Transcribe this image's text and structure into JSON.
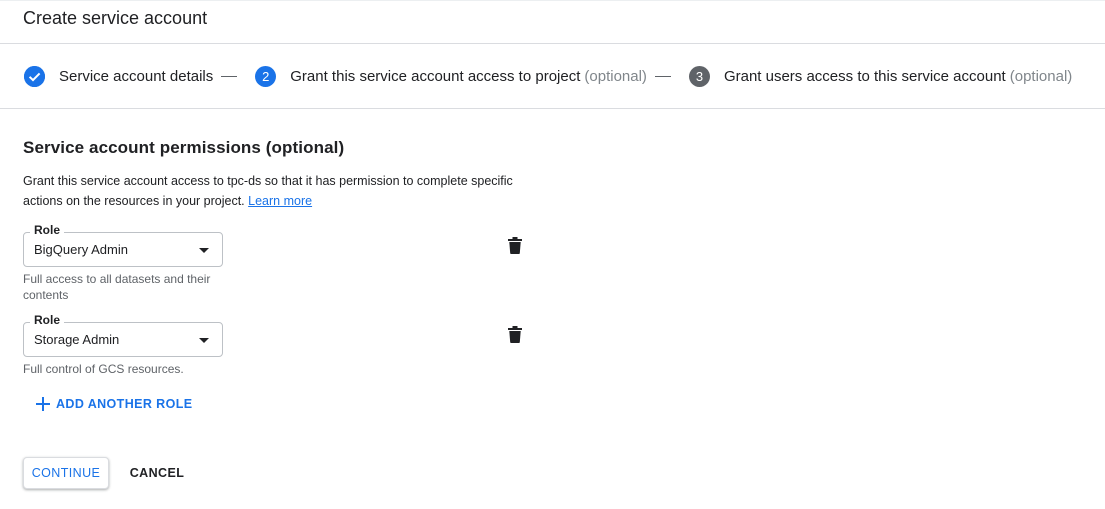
{
  "header": {
    "title": "Create service account"
  },
  "stepper": {
    "steps": [
      {
        "badge": "",
        "label": "Service account details",
        "optional": "",
        "state": "done"
      },
      {
        "badge": "2",
        "label": "Grant this service account access to project",
        "optional": "(optional)",
        "state": "active"
      },
      {
        "badge": "3",
        "label": "Grant users access to this service account",
        "optional": "(optional)",
        "state": "inactive"
      }
    ]
  },
  "permissions": {
    "title": "Service account permissions (optional)",
    "description": "Grant this service account access to tpc-ds so that it has permission to complete specific actions on the resources in your project.",
    "learn_more": "Learn more",
    "roles": [
      {
        "label": "Role",
        "value": "BigQuery Admin",
        "helper": "Full access to all datasets and their contents"
      },
      {
        "label": "Role",
        "value": "Storage Admin",
        "helper": "Full control of GCS resources."
      }
    ],
    "add_role": "ADD ANOTHER ROLE"
  },
  "actions": {
    "continue": "CONTINUE",
    "cancel": "CANCEL"
  },
  "colors": {
    "accent": "#1a73e8",
    "inactive_step": "#5f6368",
    "divider": "#dadce0"
  },
  "icons": {
    "step_done": "check-circle-icon",
    "delete": "trash-icon",
    "dropdown": "arrow-drop-down-icon",
    "add": "plus-icon"
  }
}
